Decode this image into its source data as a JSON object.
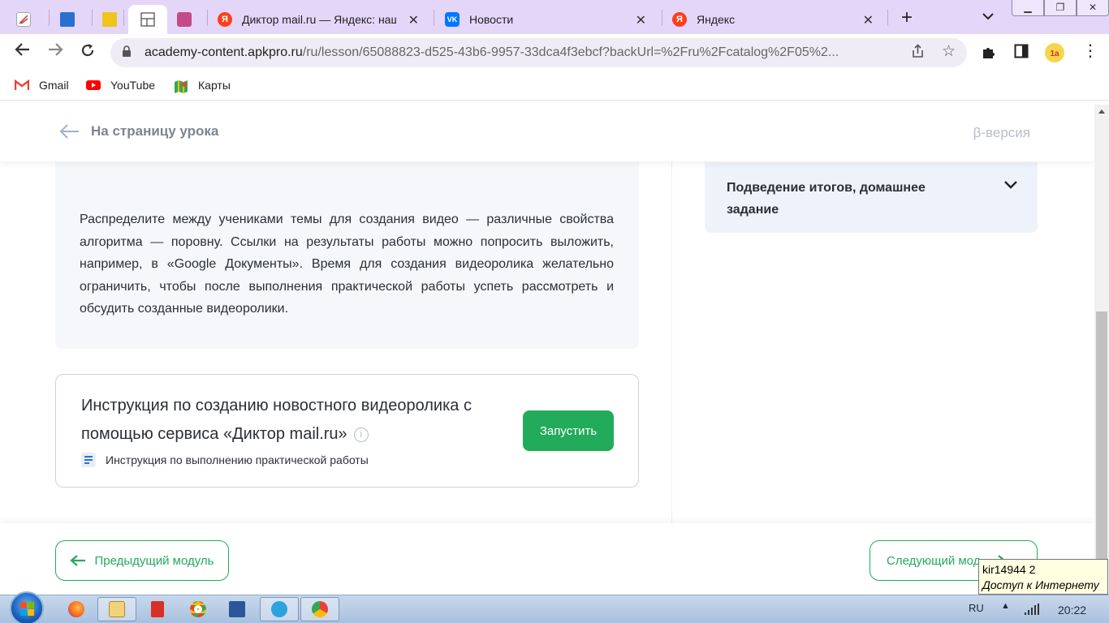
{
  "browser": {
    "tabs": [
      {
        "title": "",
        "icon": "app-icon-1"
      },
      {
        "title": "",
        "icon": "book-icon"
      },
      {
        "title": "",
        "icon": "pencil-icon"
      },
      {
        "title": "",
        "icon": "layout-icon",
        "active": true
      },
      {
        "title": "",
        "icon": "picture-icon"
      },
      {
        "title": "Диктор mail.ru — Яндекс: нашлось",
        "icon": "yandex-icon"
      },
      {
        "title": "Новости",
        "icon": "vk-icon"
      },
      {
        "title": "Яндекс",
        "icon": "yandex-icon"
      }
    ],
    "url_host": "academy-content.apkpro.ru",
    "url_path": "/ru/lesson/65088823-d525-43b6-9957-33dca4f3ebcf?backUrl=%2Fru%2Fcatalog%2F05%2...",
    "bookmarks": [
      {
        "label": "Gmail",
        "icon": "gmail-icon"
      },
      {
        "label": "YouTube",
        "icon": "youtube-icon"
      },
      {
        "label": "Карты",
        "icon": "maps-icon"
      }
    ]
  },
  "page": {
    "back_label": "На страницу урока",
    "beta_label": "β-версия",
    "task_text": "Распределите между учениками темы для создания видео — различные свойства алгоритма — поровну. Ссылки на результаты работы можно попросить выложить, например, в «Google Документы». Время для создания видеоролика желательно ограничить, чтобы после выполнения практической работы успеть рассмотреть и обсудить созданные видеоролики.",
    "instruction": {
      "title": "Инструкция по созданию новостного видеоролика с помощью сервиса «Диктор mail.ru»",
      "info_glyph": "i",
      "subtitle": "Инструкция по выполнению практической работы",
      "launch_label": "Запустить"
    },
    "sidebar": {
      "item_title": "Подведение итогов, домашнее задание"
    },
    "footer": {
      "prev_label": "Предыдущий модуль",
      "next_label": "Следующий мод"
    }
  },
  "tooltip": {
    "line1": "kir14944  2",
    "line2": "Доступ к Интернету"
  },
  "taskbar": {
    "language": "RU",
    "clock": "20:22"
  },
  "colors": {
    "accent_green": "#22ab5a",
    "tabstrip": "#e4d6f8"
  }
}
